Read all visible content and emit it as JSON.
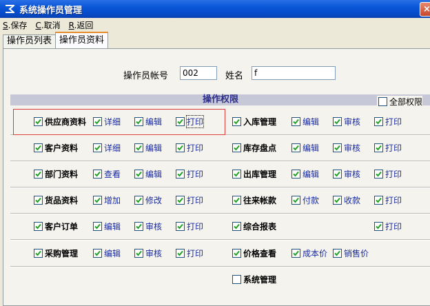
{
  "window": {
    "title": "系统操作员管理",
    "close_glyph": "×"
  },
  "menu": [
    {
      "key": "S",
      "label": ".保存"
    },
    {
      "key": "C",
      "label": ".取消"
    },
    {
      "key": "R",
      "label": ".返回"
    }
  ],
  "tabs": [
    {
      "label": "操作员列表",
      "active": false
    },
    {
      "label": "操作员资料",
      "active": true
    }
  ],
  "form": {
    "account_label": "操作员帐号",
    "account_value": "002",
    "name_label": "姓名",
    "name_value": "f"
  },
  "permissions": {
    "header": "操作权限",
    "all_label": "全部权限",
    "all_checked": false,
    "left_groups": [
      {
        "name": "供应商资料",
        "checked": true,
        "subs": [
          {
            "label": "详细",
            "checked": true
          },
          {
            "label": "编辑",
            "checked": true
          },
          {
            "label": "打印",
            "checked": true
          }
        ]
      },
      {
        "name": "客户资料",
        "checked": true,
        "subs": [
          {
            "label": "详细",
            "checked": true
          },
          {
            "label": "编辑",
            "checked": true
          },
          {
            "label": "打印",
            "checked": true
          }
        ]
      },
      {
        "name": "部门资料",
        "checked": true,
        "subs": [
          {
            "label": "查看",
            "checked": true
          },
          {
            "label": "编辑",
            "checked": true
          },
          {
            "label": "打印",
            "checked": true
          }
        ]
      },
      {
        "name": "货品资料",
        "checked": true,
        "subs": [
          {
            "label": "增加",
            "checked": true
          },
          {
            "label": "修改",
            "checked": true
          },
          {
            "label": "打印",
            "checked": true
          }
        ]
      },
      {
        "name": "客户订单",
        "checked": true,
        "subs": [
          {
            "label": "编辑",
            "checked": true
          },
          {
            "label": "审核",
            "checked": true
          },
          {
            "label": "打印",
            "checked": true
          }
        ]
      },
      {
        "name": "采购管理",
        "checked": true,
        "subs": [
          {
            "label": "编辑",
            "checked": true
          },
          {
            "label": "审核",
            "checked": true
          },
          {
            "label": "打印",
            "checked": true
          }
        ]
      }
    ],
    "right_groups": [
      {
        "name": "入库管理",
        "checked": true,
        "subs": [
          {
            "label": "编辑",
            "checked": true
          },
          {
            "label": "审核",
            "checked": true
          },
          {
            "label": "打印",
            "checked": true
          }
        ]
      },
      {
        "name": "库存盘点",
        "checked": true,
        "subs": [
          {
            "label": "编辑",
            "checked": true
          },
          {
            "label": "审核",
            "checked": true
          },
          {
            "label": "打印",
            "checked": true
          }
        ]
      },
      {
        "name": "出库管理",
        "checked": true,
        "subs": [
          {
            "label": "编辑",
            "checked": true
          },
          {
            "label": "审核",
            "checked": true
          },
          {
            "label": "打印",
            "checked": true
          }
        ]
      },
      {
        "name": "往来帐款",
        "checked": true,
        "subs": [
          {
            "label": "付款",
            "checked": true
          },
          {
            "label": "收款",
            "checked": true
          },
          {
            "label": "打印",
            "checked": true
          }
        ]
      },
      {
        "name": "综合报表",
        "checked": true,
        "subs": [
          null,
          null,
          {
            "label": "打印",
            "checked": true
          }
        ]
      },
      {
        "name": "价格查看",
        "checked": true,
        "subs": [
          {
            "label": "成本价",
            "checked": true
          },
          {
            "label": "销售价",
            "checked": true
          },
          null
        ]
      },
      {
        "name": "系统管理",
        "checked": false,
        "subs": [
          null,
          null,
          null
        ]
      }
    ]
  },
  "colors": {
    "accent": "#0a57d8",
    "highlight_box": "#d63a3a",
    "sub_label": "#1a2ba0"
  }
}
